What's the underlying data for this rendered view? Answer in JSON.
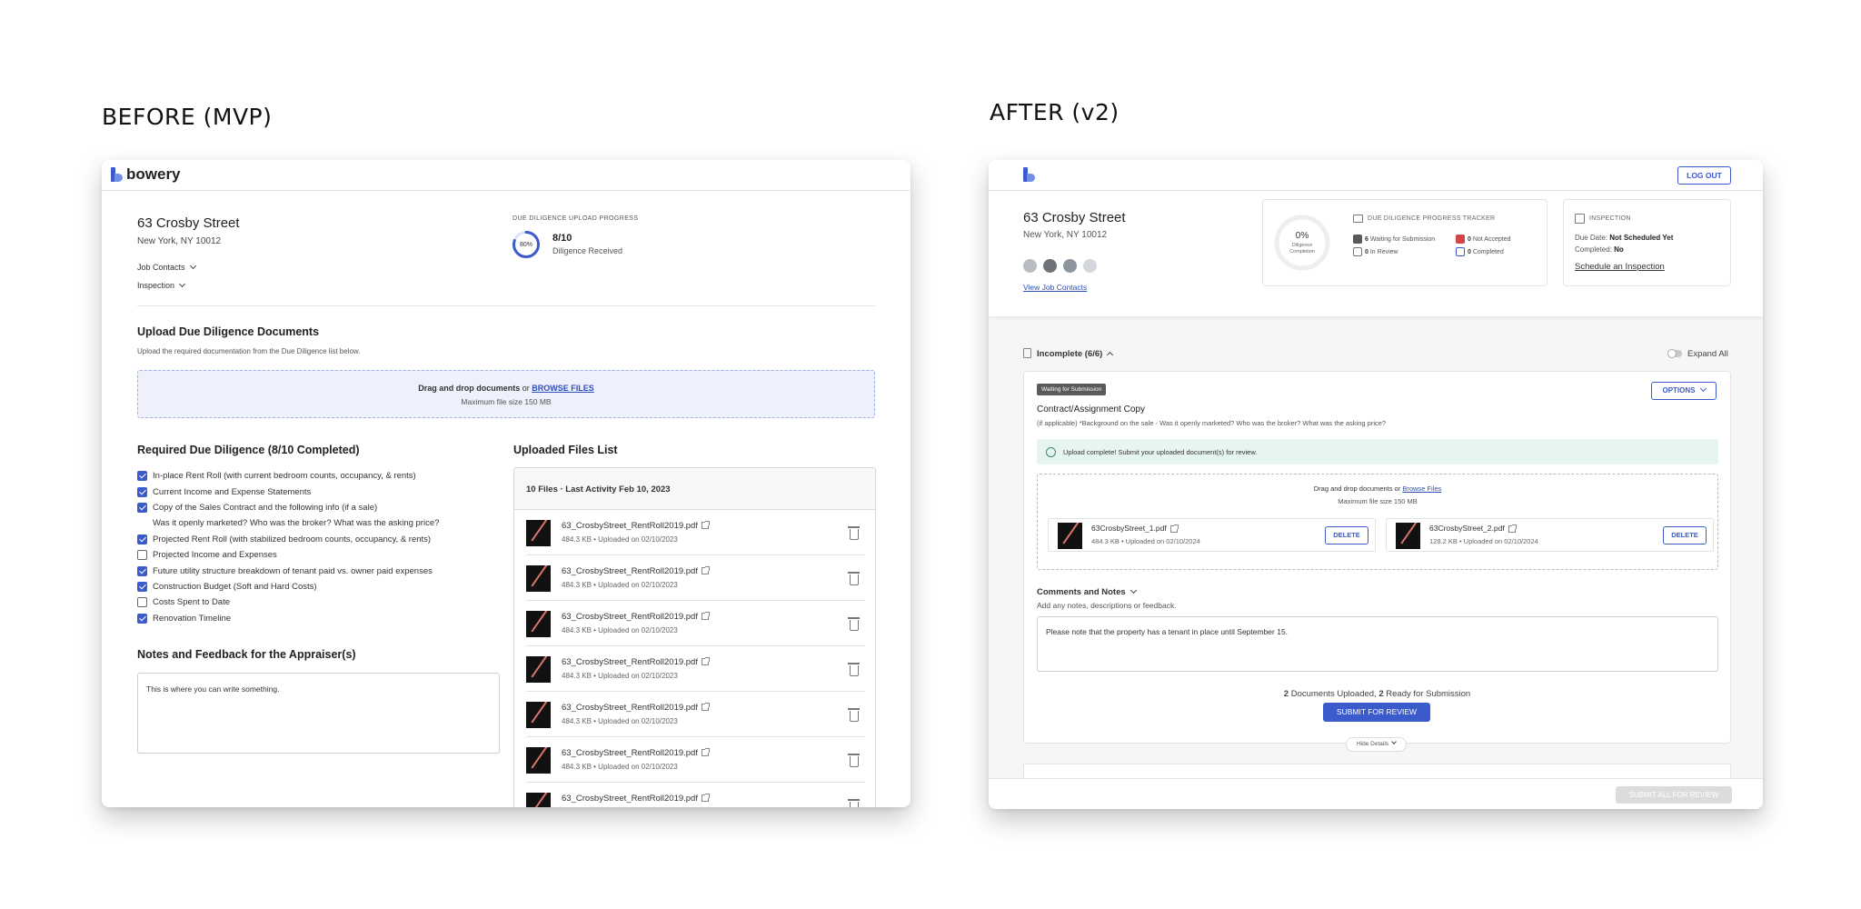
{
  "labels": {
    "before": "BEFORE (MVP)",
    "after": "AFTER (v2)"
  },
  "before": {
    "brand": "bowery",
    "address": {
      "street": "63 Crosby Street",
      "city": "New York, NY 10012"
    },
    "job_contacts": "Job Contacts",
    "inspection": "Inspection",
    "progress": {
      "heading": "DUE DILIGENCE UPLOAD PROGRESS",
      "percent_label": "80%",
      "percent": 80,
      "count": "8/10",
      "caption": "Diligence Received"
    },
    "upload": {
      "title": "Upload Due Diligence Documents",
      "subtitle": "Upload the required documentation from the Due Diligence list below.",
      "drop_prefix": "Drag and drop documents",
      "drop_or": " or ",
      "drop_link": "BROWSE FILES",
      "max_size": "Maximum file size 150 MB"
    },
    "required": {
      "title": "Required Due Diligence (8/10 Completed)",
      "items": [
        {
          "label": "In-place Rent Roll (with current bedroom counts, occupancy, & rents)",
          "checked": true
        },
        {
          "label": "Current Income and Expense Statements",
          "checked": true
        },
        {
          "label": "Copy of the Sales Contract and the following info (if a sale)",
          "checked": true
        },
        {
          "label": "Was it openly marketed? Who was the broker? What was the asking price?",
          "checked": null
        },
        {
          "label": "Projected Rent Roll (with stabilized bedroom counts, occupancy, & rents)",
          "checked": true
        },
        {
          "label": "Projected Income and Expenses",
          "checked": false
        },
        {
          "label": "Future utility structure breakdown of tenant paid vs. owner paid expenses",
          "checked": true
        },
        {
          "label": "Construction Budget (Soft and Hard Costs)",
          "checked": true
        },
        {
          "label": "Costs Spent to Date",
          "checked": false
        },
        {
          "label": "Renovation Timeline",
          "checked": true
        }
      ]
    },
    "notes": {
      "title": "Notes and Feedback for the Appraiser(s)",
      "text": "This is where you can write something."
    },
    "files": {
      "title": "Uploaded Files List",
      "summary": "10 Files · Last Activity Feb 10, 2023",
      "items": [
        {
          "name": "63_CrosbyStreet_RentRoll2019.pdf",
          "meta": "484.3 KB • Uploaded on 02/10/2023"
        },
        {
          "name": "63_CrosbyStreet_RentRoll2019.pdf",
          "meta": "484.3 KB • Uploaded on 02/10/2023"
        },
        {
          "name": "63_CrosbyStreet_RentRoll2019.pdf",
          "meta": "484.3 KB • Uploaded on 02/10/2023"
        },
        {
          "name": "63_CrosbyStreet_RentRoll2019.pdf",
          "meta": "484.3 KB • Uploaded on 02/10/2023"
        },
        {
          "name": "63_CrosbyStreet_RentRoll2019.pdf",
          "meta": "484.3 KB • Uploaded on 02/10/2023"
        },
        {
          "name": "63_CrosbyStreet_RentRoll2019.pdf",
          "meta": "484.3 KB • Uploaded on 02/10/2023"
        },
        {
          "name": "63_CrosbyStreet_RentRoll2019.pdf",
          "meta": ""
        }
      ]
    }
  },
  "after": {
    "logout": "LOG OUT",
    "address": {
      "street": "63 Crosby Street",
      "city": "New York, NY 10012"
    },
    "view_contacts": "View Job Contacts",
    "completion": {
      "percent_label": "0%",
      "percent": 0,
      "line1": "Diligence",
      "line2": "Completion"
    },
    "tracker": {
      "heading": "DUE DILIGENCE PROGRESS TRACKER",
      "waiting": {
        "count": "6",
        "label": "Waiting for Submission"
      },
      "not_accepted": {
        "count": "0",
        "label": "Not Accepted"
      },
      "in_review": {
        "count": "0",
        "label": "In Review"
      },
      "completed": {
        "count": "0",
        "label": "Completed"
      }
    },
    "inspection": {
      "heading": "INSPECTION",
      "due_label": "Due Date:",
      "due_value": "Not Scheduled Yet",
      "completed_label": "Completed:",
      "completed_value": "No",
      "schedule": "Schedule an Inspection"
    },
    "section": {
      "title": "Incomplete (6/6)",
      "expand": "Expand All"
    },
    "card": {
      "status": "Waiting for Submission",
      "options": "OPTIONS",
      "title": "Contract/Assignment Copy",
      "description": "(if applicable) *Background on the sale - Was it openly marketed? Who was the broker? What was the asking price?",
      "banner": "Upload complete! Submit your uploaded document(s) for review.",
      "drop_prefix": "Drag and drop documents",
      "drop_or": " or ",
      "drop_link": "Browse Files",
      "max_size": "Maximum file size 150 MB",
      "files": [
        {
          "name": "63CrosbyStreet_1.pdf",
          "meta": "484.3 KB • Uploaded on 02/10/2024",
          "action": "DELETE"
        },
        {
          "name": "63CrosbyStreet_2.pdf",
          "meta": "128.2 KB • Uploaded on 02/10/2024",
          "action": "DELETE"
        }
      ],
      "comments_title": "Comments and Notes",
      "comments_hint": "Add any notes, descriptions or feedback.",
      "comments_text": "Please note that the property has a tenant in place until September 15.",
      "summary_count1": "2",
      "summary_text1": " Documents Uploaded, ",
      "summary_count2": "2",
      "summary_text2": " Ready for Submission",
      "submit": "SUBMIT FOR REVIEW",
      "hide": "Hide Details"
    },
    "submit_all": "SUBMIT ALL FOR REVIEW"
  },
  "colors": {
    "accent": "#3b5bcc",
    "danger": "#d64545",
    "success_bg": "#e6f5ef",
    "dark_badge": "#5a5a5a"
  }
}
